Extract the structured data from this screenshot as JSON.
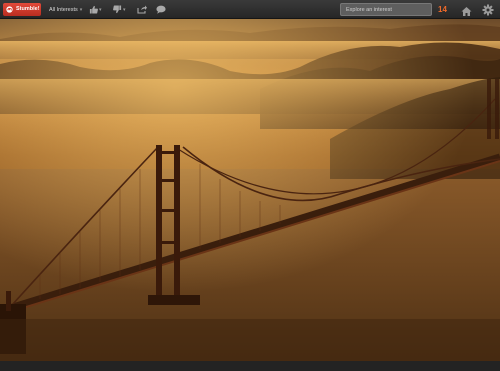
{
  "toolbar": {
    "logo_label": "StumbleUpon",
    "logo_text_short": "Stumble!",
    "interests_label": "All Interests",
    "search_placeholder": "Explore an interest",
    "badge_count": "14"
  },
  "icons": {
    "logo": "stumble-logo-icon",
    "thumbs_up": "thumbs-up-icon",
    "thumbs_down": "thumbs-down-icon",
    "share": "share-icon",
    "comment": "comment-icon",
    "home": "home-icon",
    "settings": "gear-icon"
  },
  "colors": {
    "brand": "#d8392b",
    "badge": "#f06a2a",
    "toolbar": "#2f2f2f"
  },
  "content": {
    "image_subject": "golden-gate-bridge-fog-sunset"
  }
}
